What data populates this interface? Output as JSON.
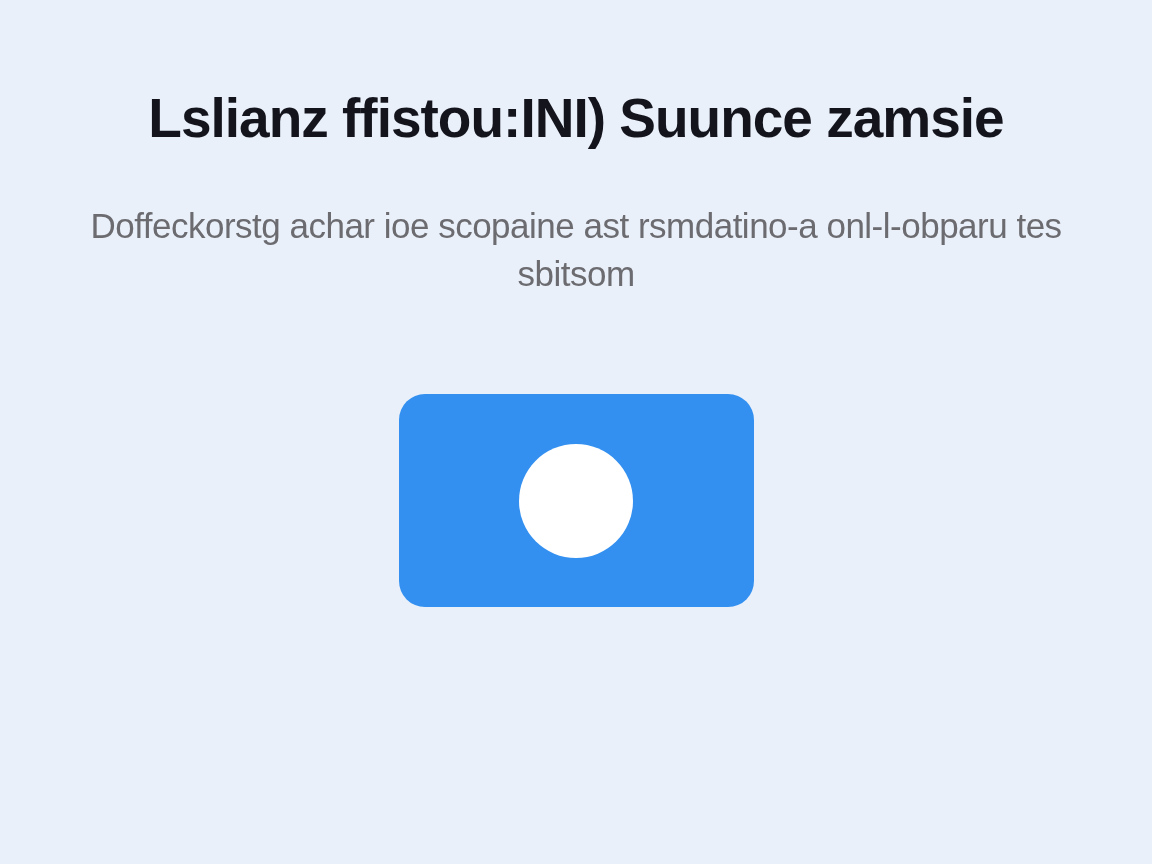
{
  "title": "Lslianz ffistou:INI) Suunce zamsie",
  "subtitle": "Doffeckorstg achar ioe scopaine ast rsmdatino-a onl-l-obparu tes sbitsom",
  "button": {
    "kind": "circle"
  }
}
